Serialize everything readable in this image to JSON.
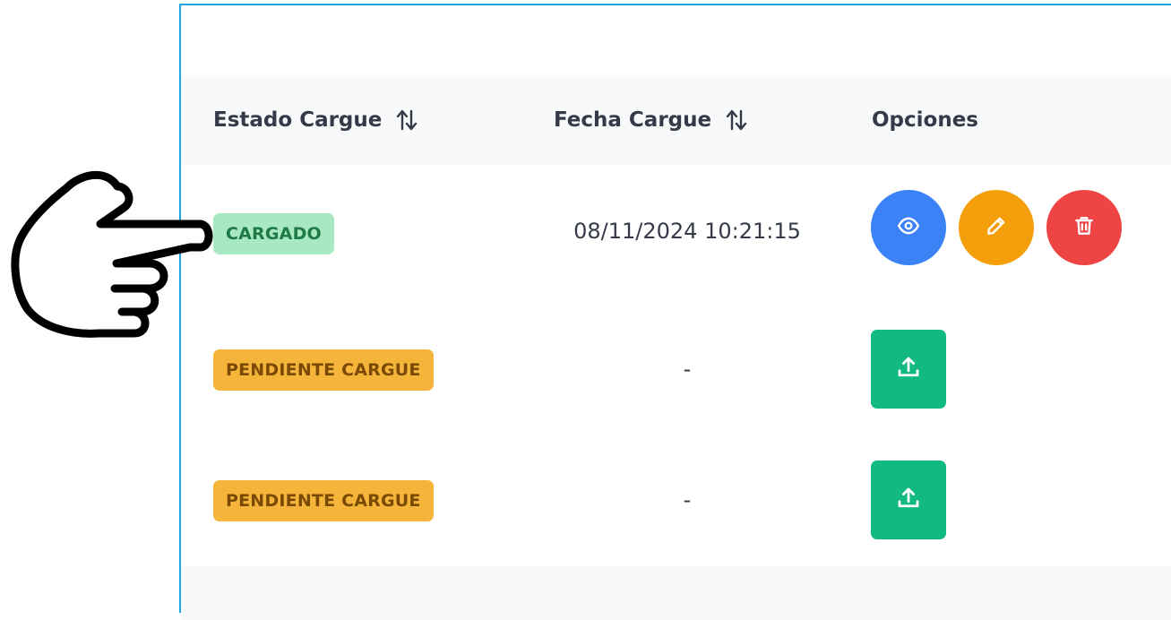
{
  "table": {
    "headers": {
      "estado": "Estado Cargue",
      "fecha": "Fecha Cargue",
      "opciones": "Opciones"
    },
    "rows": [
      {
        "status": "CARGADO",
        "status_color": "#a8e8c2",
        "date": "08/11/2024 10:21:15",
        "actions": [
          "eye-icon",
          "pencil-icon",
          "trash-icon"
        ]
      },
      {
        "status": "PENDIENTE CARGUE",
        "status_color": "#f5b43a",
        "date": "-",
        "actions": [
          "upload-icon"
        ]
      },
      {
        "status": "PENDIENTE CARGUE",
        "status_color": "#f5b43a",
        "date": "-",
        "actions": [
          "upload-icon"
        ]
      }
    ]
  },
  "colors": {
    "accent_border": "#1fa6e0",
    "view_button": "#3b82f6",
    "edit_button": "#f59e0b",
    "delete_button": "#ef4444",
    "upload_button": "#12b981"
  },
  "annotation": {
    "icon": "pointing-hand-icon"
  }
}
